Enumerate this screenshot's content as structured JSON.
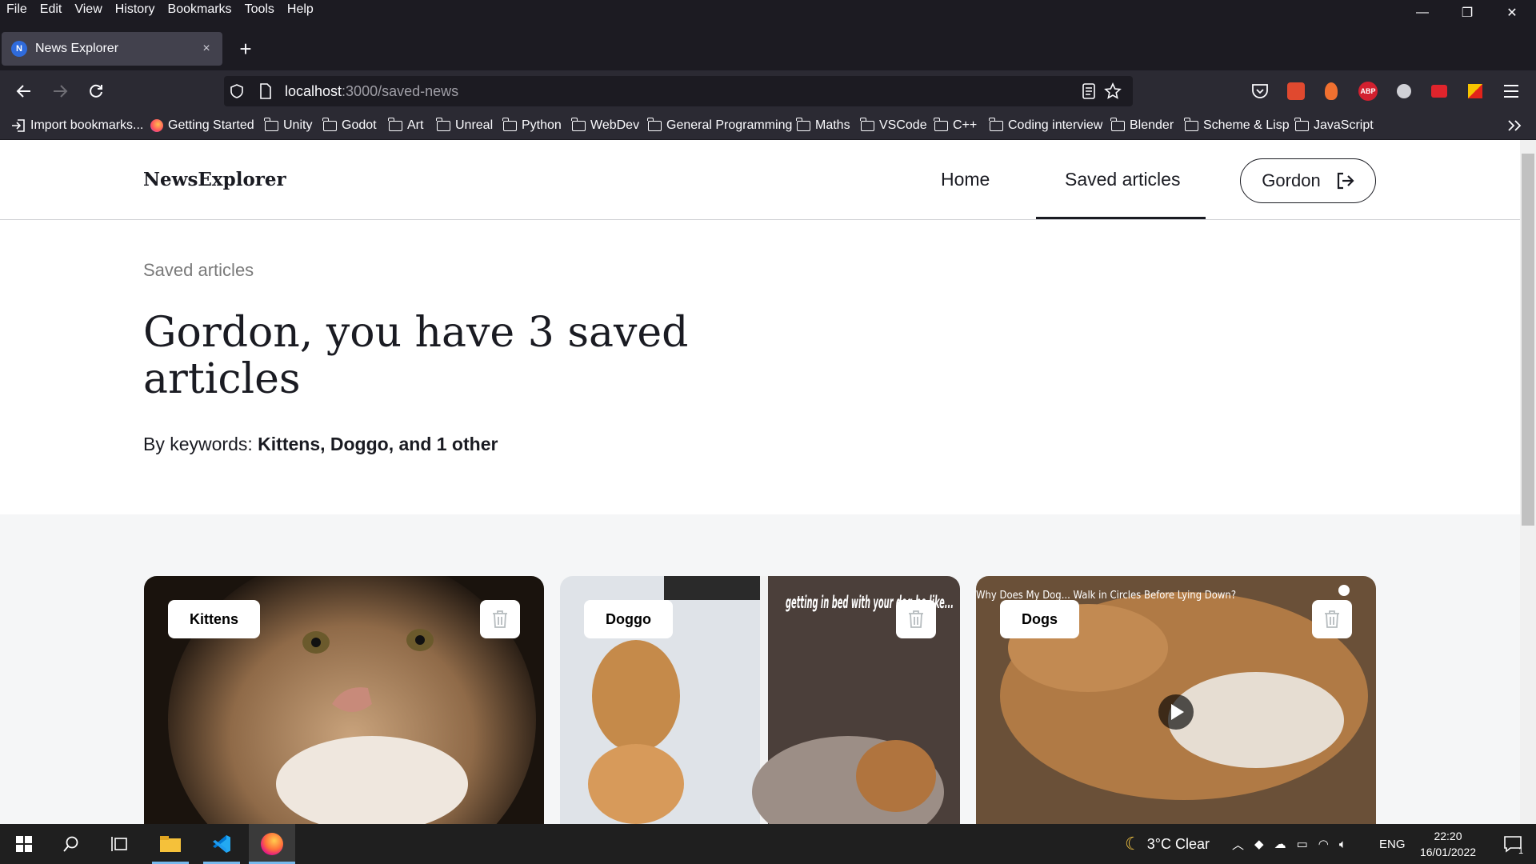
{
  "menu": [
    "File",
    "Edit",
    "View",
    "History",
    "Bookmarks",
    "Tools",
    "Help"
  ],
  "window_controls": {
    "minimize": "—",
    "restore": "❐",
    "close": "✕"
  },
  "tab": {
    "favicon_letter": "N",
    "title": "News Explorer",
    "close": "×",
    "new_tab": "+"
  },
  "url": {
    "host": "localhost",
    "path": ":3000/saved-news"
  },
  "toolbar_icons": {
    "abp": "ABP"
  },
  "bookmarks": [
    "Import bookmarks...",
    "Getting Started",
    "Unity",
    "Godot",
    "Art",
    "Unreal",
    "Python",
    "WebDev",
    "General Programming",
    "Maths",
    "VSCode",
    "C++",
    "Coding interview",
    "Blender",
    "Scheme & Lisp",
    "JavaScript"
  ],
  "site": {
    "logo": "NewsExplorer",
    "nav": {
      "home": "Home",
      "saved": "Saved articles"
    },
    "user_button": "Gordon",
    "subtitle": "Saved articles",
    "headline": "Gordon, you have 3 saved articles",
    "keywords_prefix": "By keywords: ",
    "keywords_value": "Kittens, Doggo, and 1 other",
    "cards": [
      {
        "tag": "Kittens"
      },
      {
        "tag": "Doggo",
        "overlay_text": "getting in bed with your dog be like..."
      },
      {
        "tag": "Dogs",
        "video_title": "Why Does My Dog... Walk in Circles Before Lying Down?"
      }
    ]
  },
  "taskbar": {
    "weather": "3°C  Clear",
    "language": "ENG",
    "time": "22:20",
    "date": "16/01/2022",
    "notif_count": "1"
  },
  "colors": {
    "accent": "#1a1b22",
    "browser_dark": "#1c1b22",
    "toolbar": "#2b2a33"
  }
}
